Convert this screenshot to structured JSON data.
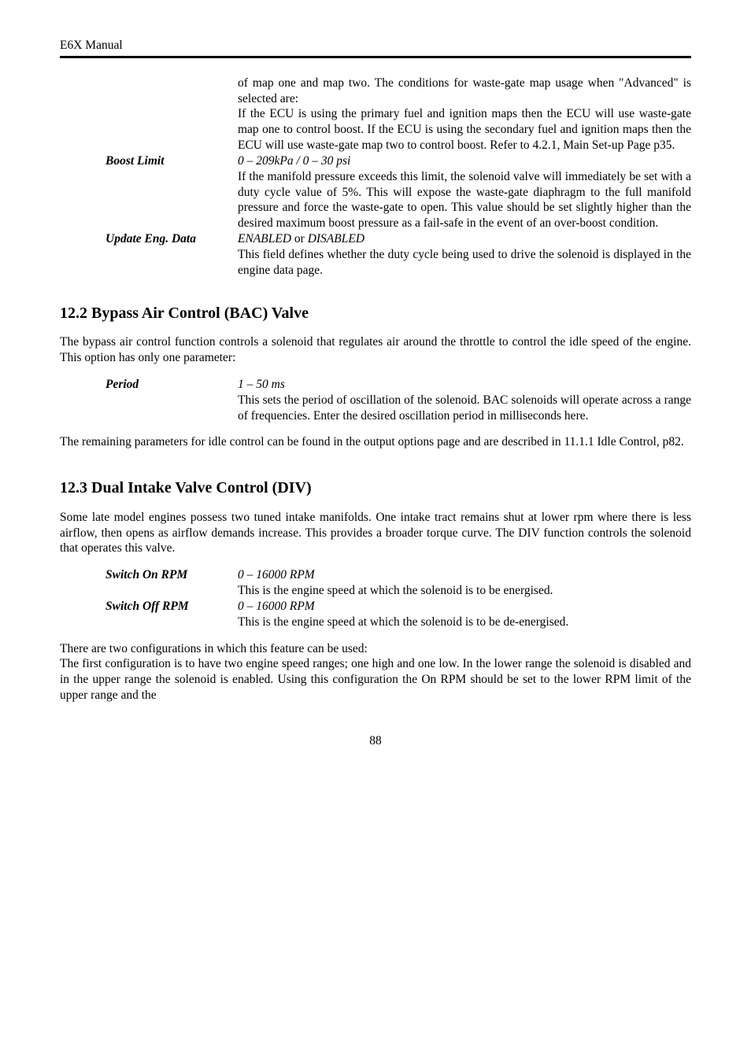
{
  "header": {
    "left": "E6X Manual"
  },
  "topblock": {
    "desc1": "of map one and map two.  The conditions for waste-gate map usage when \"Advanced\" is selected are:",
    "desc2": "If the ECU is using the primary fuel and ignition maps then the ECU will use waste-gate map one to control boost.  If the ECU is using the secondary fuel and ignition maps then the ECU will use waste-gate map two to control boost.  Refer to 4.2.1",
    "desc2_ital": ", Main Set-up Page p35",
    "desc2_end": ".",
    "boost_label": "Boost Limit",
    "boost_range": "0 – 209kPa / 0 – 30 psi",
    "boost_desc": "If the manifold pressure exceeds this limit, the solenoid valve will immediately be set with a duty cycle value of 5%. This will expose the waste-gate diaphragm to the full manifold pressure and force the waste-gate to open. This value should be set slightly higher than the desired maximum boost pressure as a fail-safe in the event of an over-boost condition.",
    "update_label": "Update Eng. Data",
    "update_range": "ENABLED",
    "update_or": " or ",
    "update_range2": "DISABLED",
    "update_desc": "This field defines whether the duty cycle being used to drive the solenoid is displayed in the engine data page."
  },
  "s122": {
    "title": "12.2 Bypass Air Control (BAC) Valve",
    "intro": "The bypass air control function controls a solenoid that regulates air around the throttle to control the idle speed of the engine.  This option has only one parameter:",
    "period_label": "Period",
    "period_range": "1 – 50 ms",
    "period_desc": "This sets the period of oscillation of the solenoid.  BAC solenoids will operate across a range of frequencies.  Enter the desired oscillation period in milliseconds here.",
    "outro_a": "The remaining parameters for idle control can be found in the output options page and are described in ",
    "outro_ital": "11.1.1 Idle Control, p82",
    "outro_b": "."
  },
  "s123": {
    "title": "12.3 Dual Intake Valve Control (DIV)",
    "intro": "Some late model engines possess two tuned intake manifolds. One intake tract remains shut at lower rpm where there is less airflow, then opens as airflow demands increase. This provides a broader torque curve. The DIV function controls the solenoid that operates this valve.",
    "on_label": "Switch On RPM",
    "on_range": "0 – 16000 RPM",
    "on_desc": "This is the engine speed at which the solenoid is to be energised.",
    "off_label": "Switch Off RPM",
    "off_range": "0 – 16000 RPM",
    "off_desc": "This is the engine speed at which the solenoid is to be de-energised.",
    "config_a": "There are two configurations in which this feature can be used:",
    "config_b": "The first configuration is to have two engine speed ranges; one high and one low.  In the lower range the solenoid is disabled and in the upper range the solenoid is enabled.  Using this configuration the On RPM should be set to the lower RPM limit of the upper range and the"
  },
  "pagenum": "88"
}
